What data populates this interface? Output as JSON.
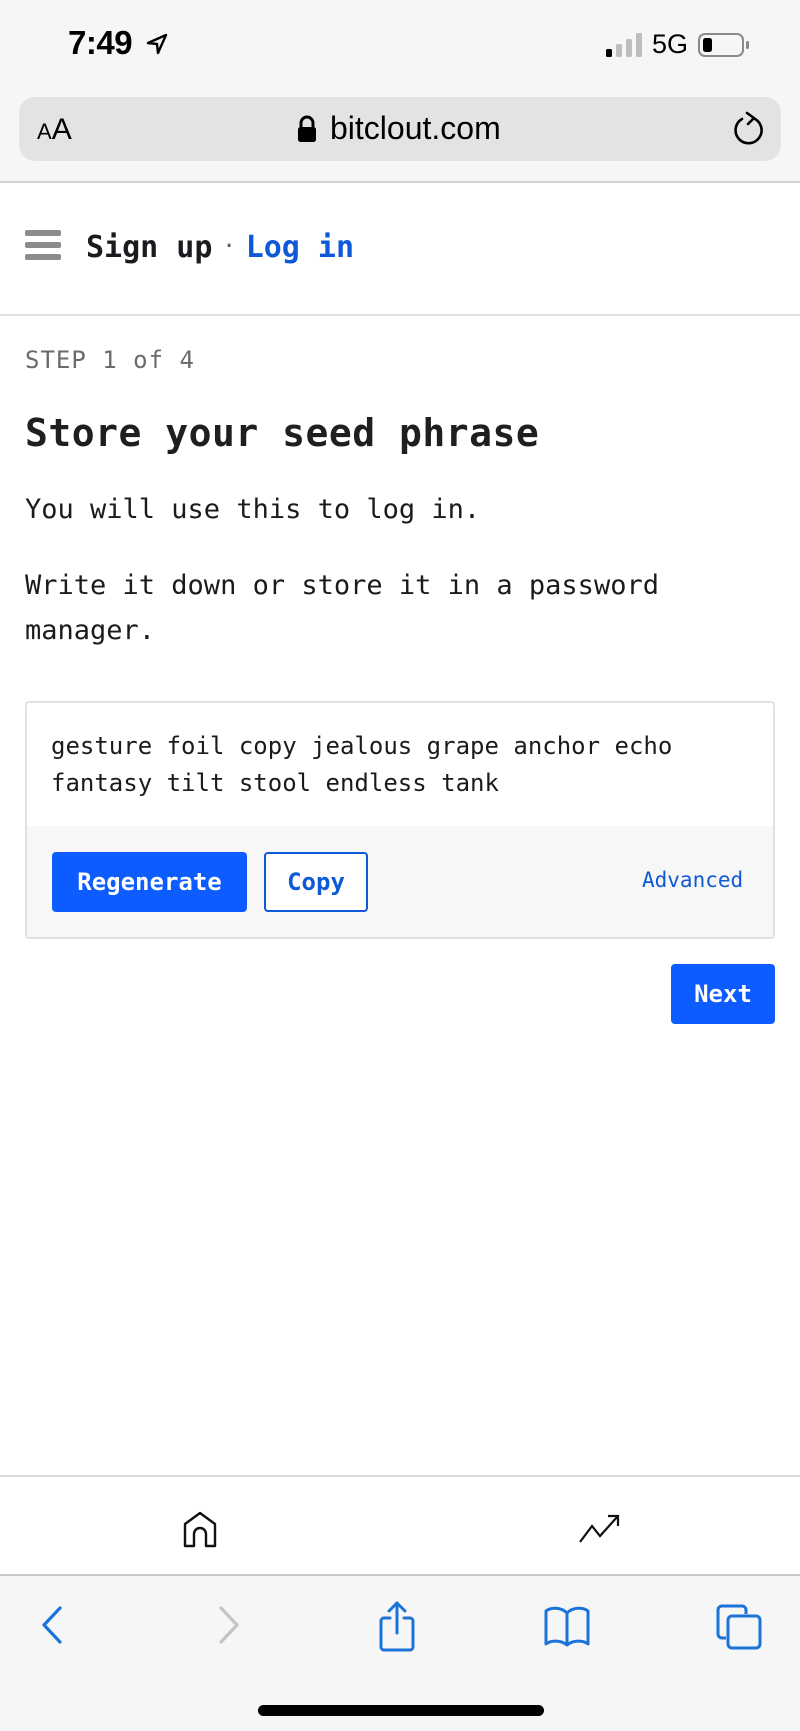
{
  "status_bar": {
    "time": "7:49",
    "network": "5G",
    "location_icon": "location-arrow-icon",
    "signal_icon": "cellular-signal-icon",
    "battery_icon": "battery-low-icon"
  },
  "address_bar": {
    "text_size_label_small": "A",
    "text_size_label_large": "A",
    "url": "bitclout.com",
    "lock_icon": "lock-icon",
    "reload_icon": "reload-icon"
  },
  "nav": {
    "menu_icon": "hamburger-menu-icon",
    "signup_label": "Sign up",
    "separator": "·",
    "login_label": "Log in"
  },
  "main": {
    "step": "STEP 1 of 4",
    "title": "Store your seed phrase",
    "paragraph_1": "You will use this to log in.",
    "paragraph_2": "Write it down or store it in a password manager.",
    "seed_phrase": "gesture foil copy jealous grape anchor echo fantasy tilt stool endless tank",
    "regenerate_label": "Regenerate",
    "copy_label": "Copy",
    "advanced_label": "Advanced",
    "next_label": "Next"
  },
  "bottom_tabs": [
    {
      "icon": "home-icon"
    },
    {
      "icon": "trending-icon"
    }
  ],
  "safari_toolbar": [
    {
      "icon": "back-chevron-icon",
      "enabled": true
    },
    {
      "icon": "forward-chevron-icon",
      "enabled": false
    },
    {
      "icon": "share-icon",
      "enabled": true
    },
    {
      "icon": "bookmarks-icon",
      "enabled": true
    },
    {
      "icon": "tabs-icon",
      "enabled": true
    }
  ],
  "colors": {
    "accent": "#0c5cff",
    "link": "#1059d6",
    "ios_blue": "#1a73d9",
    "disabled": "#c4c4c4"
  }
}
